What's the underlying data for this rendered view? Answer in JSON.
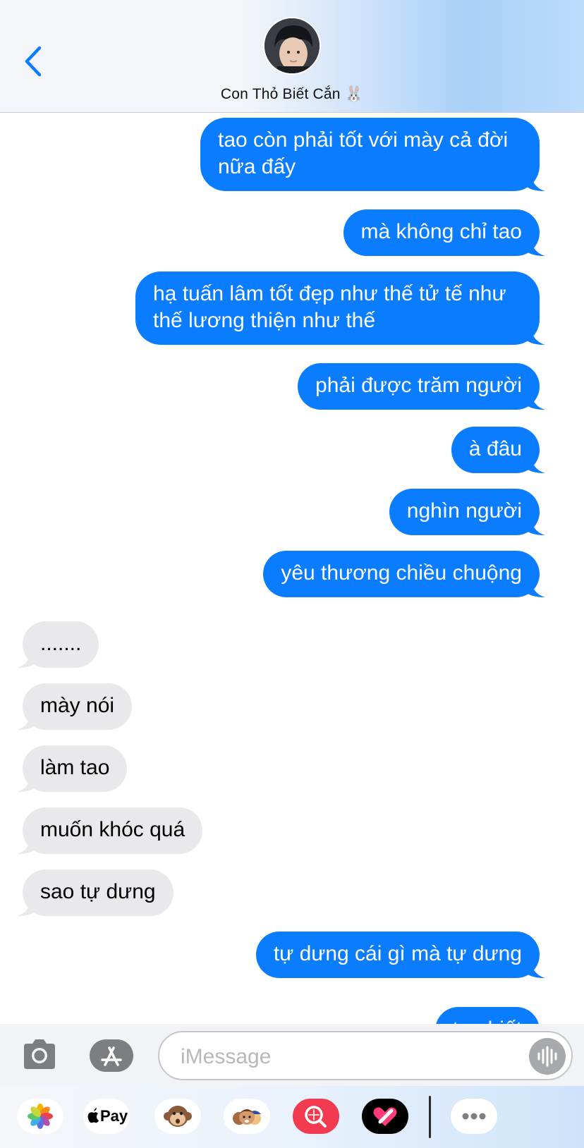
{
  "header": {
    "contact_name": "Con Thỏ Biết Cắn 🐰",
    "back_icon": "chevron-left-icon",
    "accent_color": "#0a7cff"
  },
  "messages": [
    {
      "direction": "sent",
      "text": "tao còn phải tốt với mày cả đời nữa đấy"
    },
    {
      "direction": "sent",
      "text": "mà không chỉ tao"
    },
    {
      "direction": "sent",
      "text": "hạ tuấn lâm tốt đẹp như thế tử tế như thế lương thiện như thế"
    },
    {
      "direction": "sent",
      "text": "phải được trăm người"
    },
    {
      "direction": "sent",
      "text": "à đâu"
    },
    {
      "direction": "sent",
      "text": "nghìn người"
    },
    {
      "direction": "sent",
      "text": "yêu thương chiều chuộng"
    },
    {
      "direction": "received",
      "text": "......."
    },
    {
      "direction": "received",
      "text": "mày nói"
    },
    {
      "direction": "received",
      "text": "làm tao"
    },
    {
      "direction": "received",
      "text": "muốn khóc quá"
    },
    {
      "direction": "received",
      "text": "sao tự dưng"
    },
    {
      "direction": "sent",
      "text": "tự dưng cái gì mà tự dưng"
    },
    {
      "direction": "sent",
      "text": "tao biết"
    }
  ],
  "colors": {
    "sent_bubble": "#0a7cff",
    "received_bubble": "#e9e9eb"
  },
  "compose": {
    "placeholder": "iMessage",
    "camera_icon": "camera-icon",
    "app_store_icon": "app-store-icon",
    "audio_icon": "audio-waveform-icon"
  },
  "app_drawer": [
    {
      "name": "photos-icon"
    },
    {
      "name": "apple-pay-icon",
      "label": "Pay"
    },
    {
      "name": "animoji-monkey-icon"
    },
    {
      "name": "memoji-stickers-icon"
    },
    {
      "name": "image-search-icon"
    },
    {
      "name": "digital-touch-icon"
    },
    {
      "name": "more-apps-icon"
    }
  ]
}
